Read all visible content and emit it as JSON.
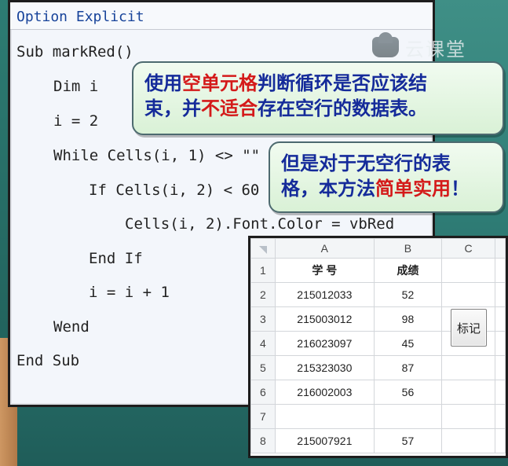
{
  "watermark": {
    "icon": "cloud-icon",
    "text": "云课堂"
  },
  "code": {
    "header": "Option Explicit",
    "lines": [
      "Sub markRed()",
      "Dim i",
      "i = 2",
      "While Cells(i, 1) <> \"\"",
      "If Cells(i, 2) < 60 Then",
      "Cells(i, 2).Font.Color = vbRed",
      "End If",
      "i = i + 1",
      "Wend",
      "End Sub"
    ]
  },
  "callouts": {
    "c1": {
      "line1": {
        "a": "使用",
        "b": "空单元格",
        "c": "判断循环是否应该结"
      },
      "line2": {
        "a": "束，并",
        "b": "不适合",
        "c": "存在空行的数据表。"
      }
    },
    "c2": {
      "line1": {
        "a": "但是对于无空行的表"
      },
      "line2": {
        "a": "格，本方法",
        "b": "简单实用",
        "c": "！"
      }
    }
  },
  "sheet": {
    "columns": [
      "A",
      "B",
      "C"
    ],
    "rows": [
      {
        "n": "1",
        "a": "学  号",
        "b": "成绩",
        "c": ""
      },
      {
        "n": "2",
        "a": "215012033",
        "b": "52",
        "c": ""
      },
      {
        "n": "3",
        "a": "215003012",
        "b": "98",
        "c": ""
      },
      {
        "n": "4",
        "a": "216023097",
        "b": "45",
        "c": ""
      },
      {
        "n": "5",
        "a": "215323030",
        "b": "87",
        "c": ""
      },
      {
        "n": "6",
        "a": "216002003",
        "b": "56",
        "c": ""
      },
      {
        "n": "7",
        "a": "",
        "b": "",
        "c": ""
      },
      {
        "n": "8",
        "a": "215007921",
        "b": "57",
        "c": ""
      }
    ],
    "button_label": "标记",
    "colors": {
      "failing_score": "#d84343"
    }
  }
}
